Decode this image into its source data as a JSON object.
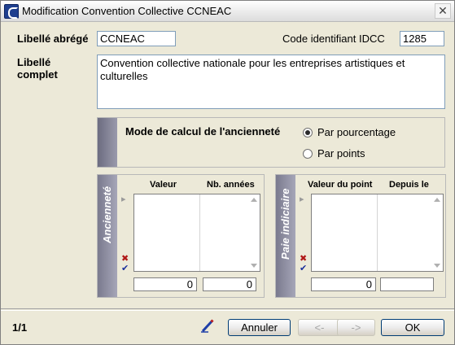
{
  "window": {
    "title": "Modification Convention Collective CCNEAC",
    "close_glyph": "✕"
  },
  "form": {
    "short_label": "Libellé abrégé",
    "short_value": "CCNEAC",
    "idcc_label": "Code identifiant IDCC",
    "idcc_value": "1285",
    "full_label_1": "Libellé",
    "full_label_2": "complet",
    "full_value": "Convention collective nationale pour les entreprises artistiques et culturelles"
  },
  "mode": {
    "title": "Mode de calcul de l'ancienneté",
    "options": [
      {
        "label": "Par pourcentage",
        "checked": true
      },
      {
        "label": "Par points",
        "checked": false
      }
    ]
  },
  "anciennete": {
    "side_label": "Ancienneté",
    "columns": [
      "Valeur",
      "Nb. années"
    ],
    "footer": [
      "0",
      "0"
    ]
  },
  "paie": {
    "side_label": "Paie indiciaire",
    "columns": [
      "Valeur du point",
      "Depuis le"
    ],
    "footer": [
      "0",
      ""
    ]
  },
  "icons": {
    "row_pointer": "▸",
    "delete": "✖",
    "validate": "✔"
  },
  "footer": {
    "page": "1/1",
    "cancel": "Annuler",
    "prev": "<-",
    "next": "->",
    "ok": "OK"
  }
}
